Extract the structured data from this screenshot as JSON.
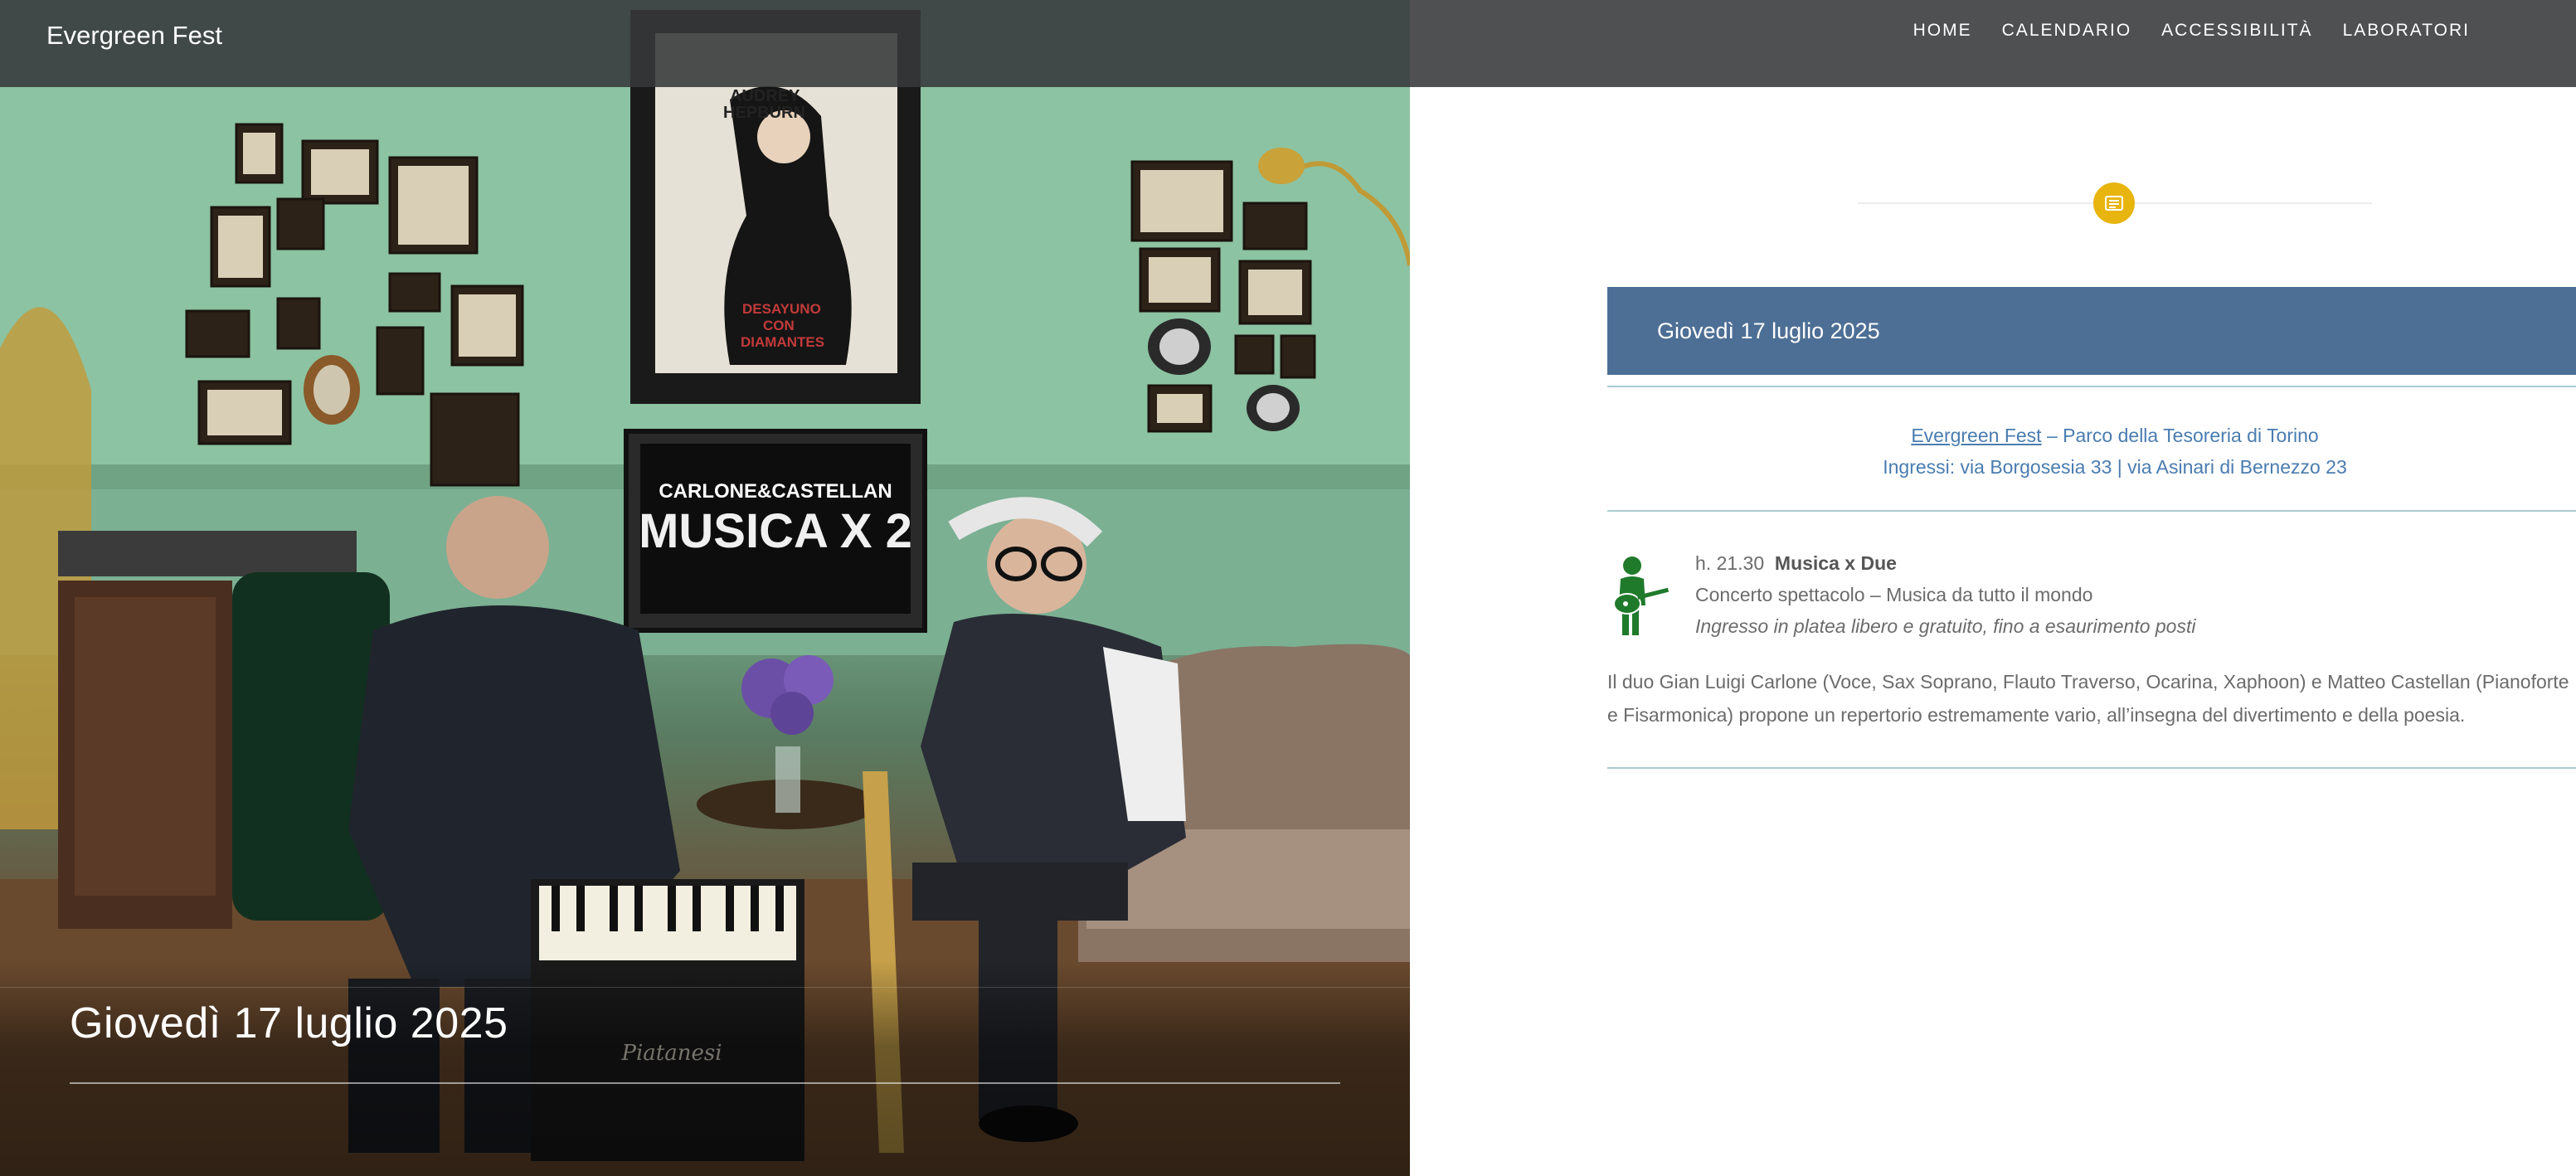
{
  "header": {
    "brand": "Evergreen Fest",
    "nav": [
      "HOME",
      "CALENDARIO",
      "ACCESSIBILITÀ",
      "LABORATORI"
    ]
  },
  "hero": {
    "title": "Giovedì 17 luglio 2025",
    "poster_text": [
      "AUDREY",
      "HEPBURN",
      "DESAYUNO",
      "CON",
      "DIAMANTES"
    ],
    "tv_text": [
      "CARLONE&CASTELLAN",
      "MUSICA X 2"
    ],
    "accordion_brand": "Piatanesi"
  },
  "content": {
    "date_banner": "Giovedì 17 luglio 2025",
    "venue": {
      "link": "Evergreen Fest",
      "rest": " – Parco della Tesoreria di Torino",
      "entrances": "Ingressi: via Borgosesia 33 | via Asinari di Bernezzo 23"
    },
    "event": {
      "time": "h. 21.30",
      "title": "Musica x Due",
      "type": "Concerto spettacolo – Musica da tutto il mondo",
      "entry": "Ingresso in platea libero e gratuito, fino a esaurimento posti"
    },
    "description": "Il duo Gian Luigi Carlone (Voce, Sax Soprano, Flauto Traverso, Ocarina, Xaphoon) e Matteo Castellan (Pianoforte e Fisarmonica) propone un repertorio estremamente vario, all’insegna del divertimento e della poesia."
  },
  "colors": {
    "topbar": "#36383a",
    "banner": "#4d6f95",
    "divider_icon": "#e8b40e",
    "link": "#4a7cb0",
    "guitarist_icon": "#1f7a2b"
  },
  "icons": {
    "divider": "calendar-list-icon",
    "event": "guitar-player-icon"
  }
}
